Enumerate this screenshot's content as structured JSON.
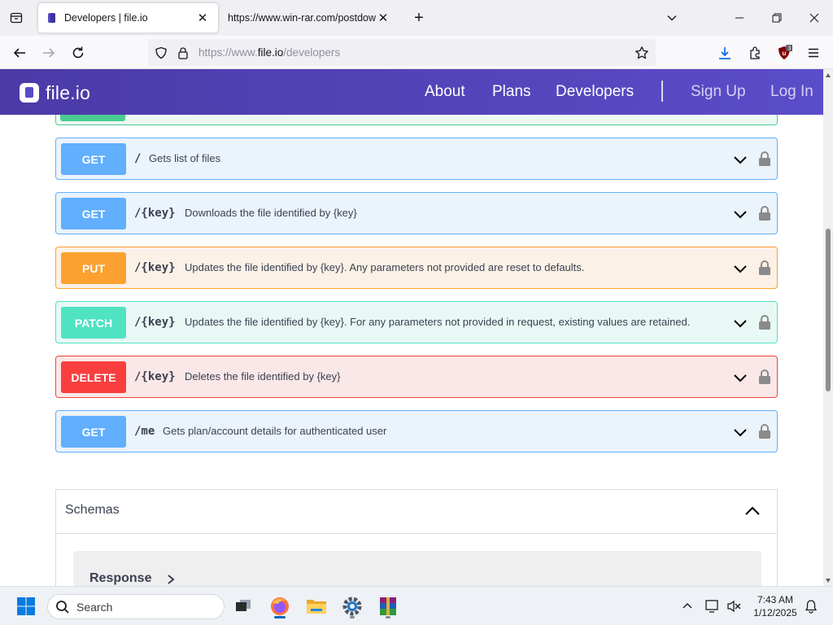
{
  "browser": {
    "tabs": [
      {
        "title": "Developers | file.io",
        "active": true
      },
      {
        "title": "https://www.win-rar.com/postdow",
        "active": false
      }
    ],
    "url": {
      "prefix": "https://www.",
      "host": "file.io",
      "path": "/developers"
    },
    "extension_badge": "3"
  },
  "site": {
    "logo_text": "file.io",
    "nav": {
      "about": "About",
      "plans": "Plans",
      "developers": "Developers",
      "sign_up": "Sign Up",
      "log_in": "Log In"
    },
    "brand_color": "#5446c0"
  },
  "operations": [
    {
      "method": "GET",
      "path": "/",
      "description": "Gets list of files",
      "kind": "get"
    },
    {
      "method": "GET",
      "path": "/{key}",
      "description": "Downloads the file identified by {key}",
      "kind": "get"
    },
    {
      "method": "PUT",
      "path": "/{key}",
      "description": "Updates the file identified by {key}. Any parameters not provided are reset to defaults.",
      "kind": "put"
    },
    {
      "method": "PATCH",
      "path": "/{key}",
      "description": "Updates the file identified by {key}. For any parameters not provided in request, existing values are retained.",
      "kind": "patch"
    },
    {
      "method": "DELETE",
      "path": "/{key}",
      "description": "Deletes the file identified by {key}",
      "kind": "delete"
    },
    {
      "method": "GET",
      "path": "/me",
      "description": "Gets plan/account details for authenticated user",
      "kind": "get"
    }
  ],
  "schemas": {
    "title": "Schemas",
    "models": [
      {
        "name": "Response"
      }
    ]
  },
  "taskbar": {
    "search_placeholder": "Search",
    "time": "7:43 AM",
    "date": "1/12/2025"
  }
}
